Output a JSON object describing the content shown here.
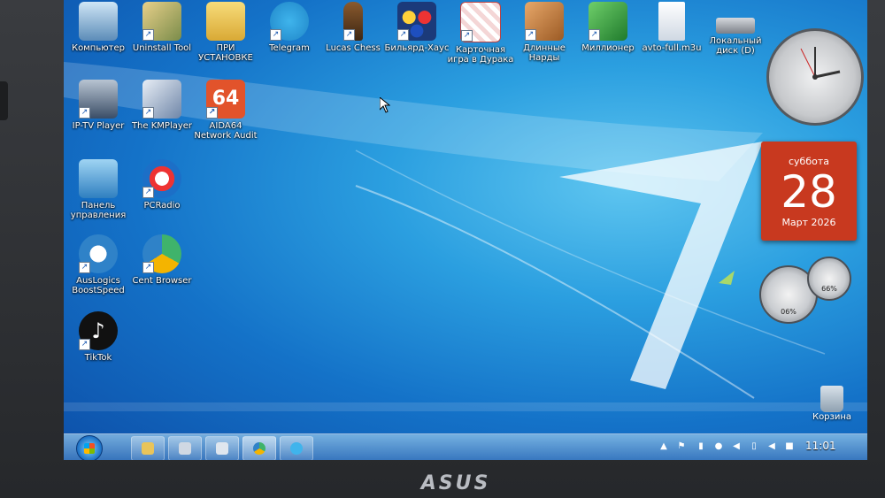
{
  "desktop": {
    "icons": [
      {
        "label": "Компьютер"
      },
      {
        "label": "Uninstall Tool"
      },
      {
        "label": "ПРИ УСТАНОВКЕ"
      },
      {
        "label": "Telegram"
      },
      {
        "label": "Lucas Chess"
      },
      {
        "label": "Бильярд-Хаус"
      },
      {
        "label": "Карточная игра в Дурака"
      },
      {
        "label": "Длинные Нарды"
      },
      {
        "label": "Миллионер"
      },
      {
        "label": "avto-full.m3u"
      },
      {
        "label": "Локальный диск (D)"
      },
      {
        "label": "IP-TV Player"
      },
      {
        "label": "The KMPlayer"
      },
      {
        "label": "AIDA64 Network Audit"
      },
      {
        "label": "Панель управления"
      },
      {
        "label": "PCRadio"
      },
      {
        "label": "AusLogics BoostSpeed"
      },
      {
        "label": "Cent Browser"
      },
      {
        "label": "TikTok"
      }
    ],
    "aida_badge": "64",
    "recycle_bin": {
      "label": "Корзина"
    }
  },
  "gadgets": {
    "calendar": {
      "weekday": "суббота",
      "day": "28",
      "month_year": "Март 2026"
    },
    "meter": {
      "cpu": "06%",
      "ram": "66%"
    }
  },
  "taskbar": {
    "time": "11:01"
  },
  "brand": {
    "logo_text": "ASUS"
  },
  "colors": {
    "accent": "#1472c8",
    "calendar": "#c8391f"
  }
}
